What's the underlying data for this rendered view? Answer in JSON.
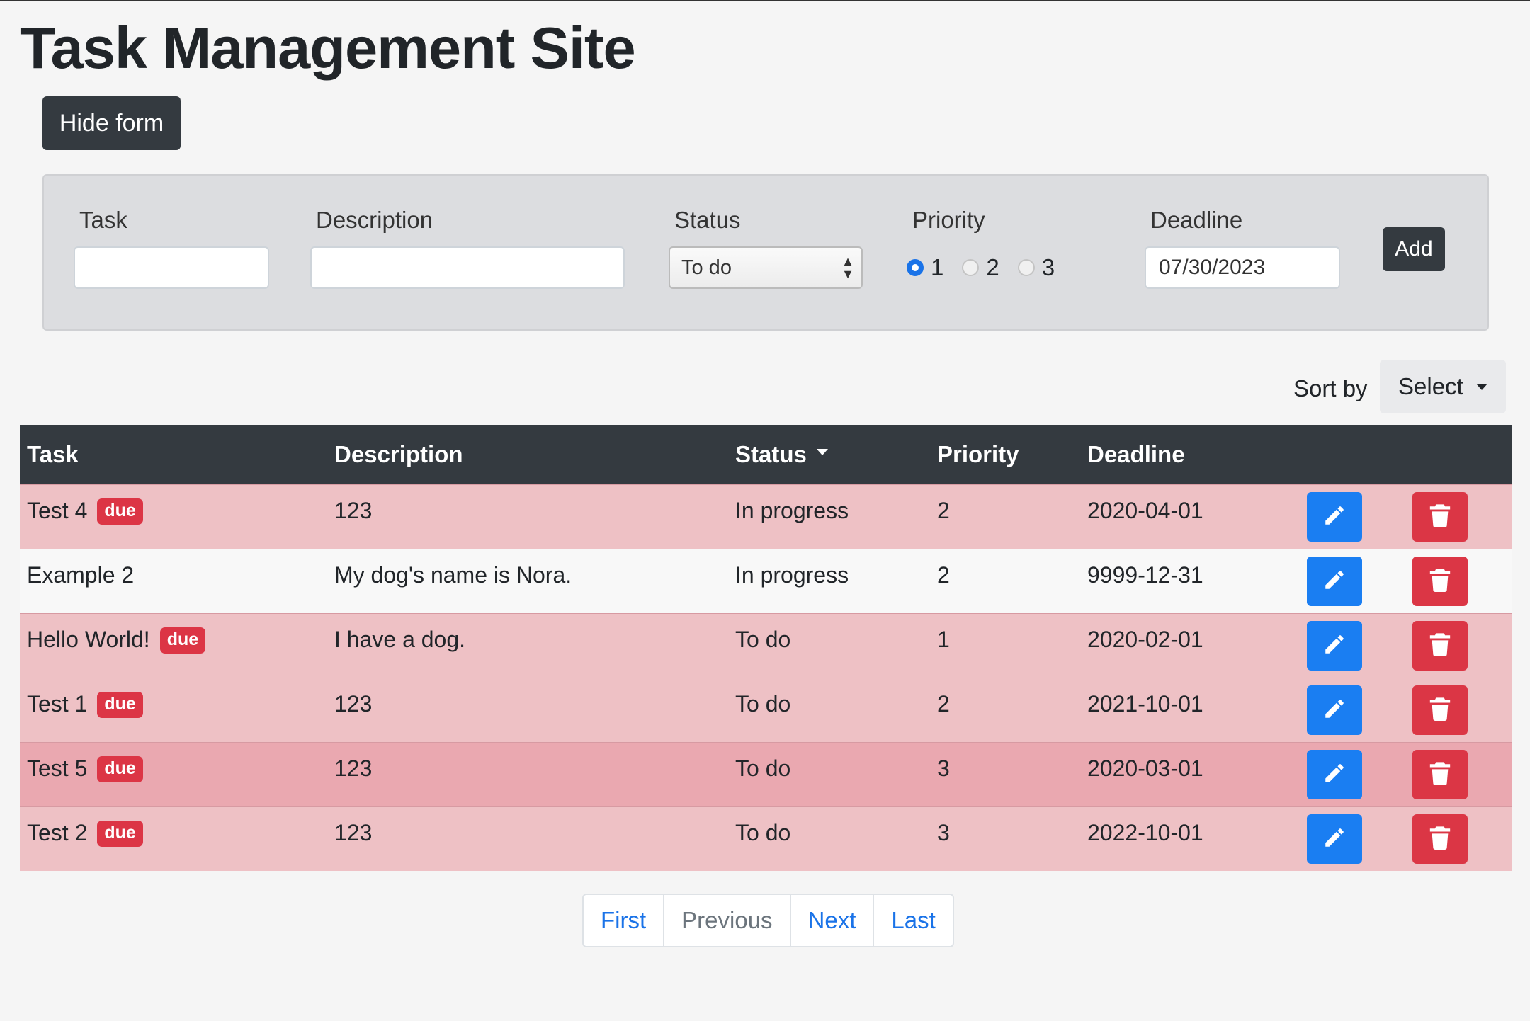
{
  "page": {
    "title": "Task Management Site"
  },
  "toggle": {
    "hide_form_label": "Hide form"
  },
  "form": {
    "task_label": "Task",
    "description_label": "Description",
    "status_label": "Status",
    "status_value": "To do",
    "priority_label": "Priority",
    "priority_options": [
      "1",
      "2",
      "3"
    ],
    "priority_selected": "1",
    "deadline_label": "Deadline",
    "deadline_value": "07/30/2023",
    "add_label": "Add"
  },
  "sort": {
    "label": "Sort by",
    "value": "Select"
  },
  "table": {
    "headers": [
      "Task",
      "Description",
      "Status",
      "Priority",
      "Deadline"
    ],
    "badge_label": "due",
    "rows": [
      {
        "task": "Test 4",
        "due": true,
        "description": "123",
        "status": "In progress",
        "priority": "2",
        "deadline": "2020-04-01"
      },
      {
        "task": "Example 2",
        "due": false,
        "description": "My dog's name is Nora.",
        "status": "In progress",
        "priority": "2",
        "deadline": "9999-12-31"
      },
      {
        "task": "Hello World!",
        "due": true,
        "description": "I have a dog.",
        "status": "To do",
        "priority": "1",
        "deadline": "2020-02-01"
      },
      {
        "task": "Test 1",
        "due": true,
        "description": "123",
        "status": "To do",
        "priority": "2",
        "deadline": "2021-10-01"
      },
      {
        "task": "Test 5",
        "due": true,
        "description": "123",
        "status": "To do",
        "priority": "3",
        "deadline": "2020-03-01"
      },
      {
        "task": "Test 2",
        "due": true,
        "description": "123",
        "status": "To do",
        "priority": "3",
        "deadline": "2022-10-01"
      }
    ]
  },
  "pagination": {
    "first": "First",
    "previous": "Previous",
    "next": "Next",
    "last": "Last"
  },
  "colors": {
    "accent": "#1a73e8",
    "danger": "#dc3545",
    "dark": "#343a40",
    "row_due": "#eec1c5"
  }
}
